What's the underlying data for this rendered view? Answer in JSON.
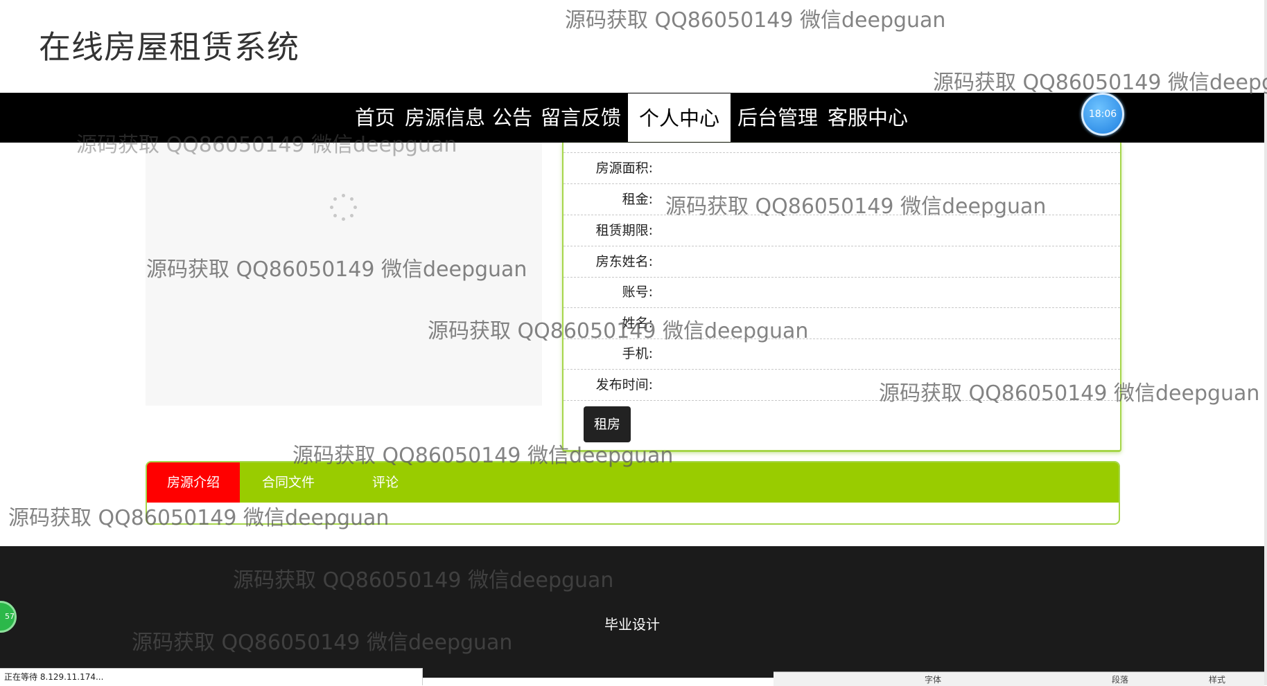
{
  "site": {
    "title": "在线房屋租赁系统"
  },
  "nav": {
    "items": [
      "首页",
      "房源信息",
      "公告",
      "留言反馈",
      "个人中心",
      "后台管理",
      "客服中心"
    ],
    "active": "个人中心"
  },
  "clock": {
    "time": "18:06"
  },
  "house_info": {
    "fields": [
      {
        "label": "房源面积:",
        "value": ""
      },
      {
        "label": "租金:",
        "value": ""
      },
      {
        "label": "租赁期限:",
        "value": ""
      },
      {
        "label": "房东姓名:",
        "value": ""
      },
      {
        "label": "账号:",
        "value": ""
      },
      {
        "label": "姓名:",
        "value": ""
      },
      {
        "label": "手机:",
        "value": ""
      },
      {
        "label": "发布时间:",
        "value": ""
      }
    ],
    "rent_button": "租房"
  },
  "tabs": {
    "items": [
      "房源介绍",
      "合同文件",
      "评论"
    ],
    "active": "房源介绍"
  },
  "footer": {
    "text": "毕业设计"
  },
  "badge": {
    "text": "57"
  },
  "status_bar": {
    "text": "正在等待 8.129.11.174..."
  },
  "taskbar_snippet": {
    "items": [
      "字体",
      "段落",
      "样式"
    ]
  },
  "watermark": {
    "text": "源码获取 QQ86050149 微信deepguan",
    "text_cut": "源码获取 QQ86050149 微信deepg"
  },
  "colors": {
    "nav_bg": "#000000",
    "tab_bar": "#99cc00",
    "tab_active": "#ff0000",
    "panel_border": "#a6d64a",
    "footer_bg": "#1b1b1b"
  }
}
